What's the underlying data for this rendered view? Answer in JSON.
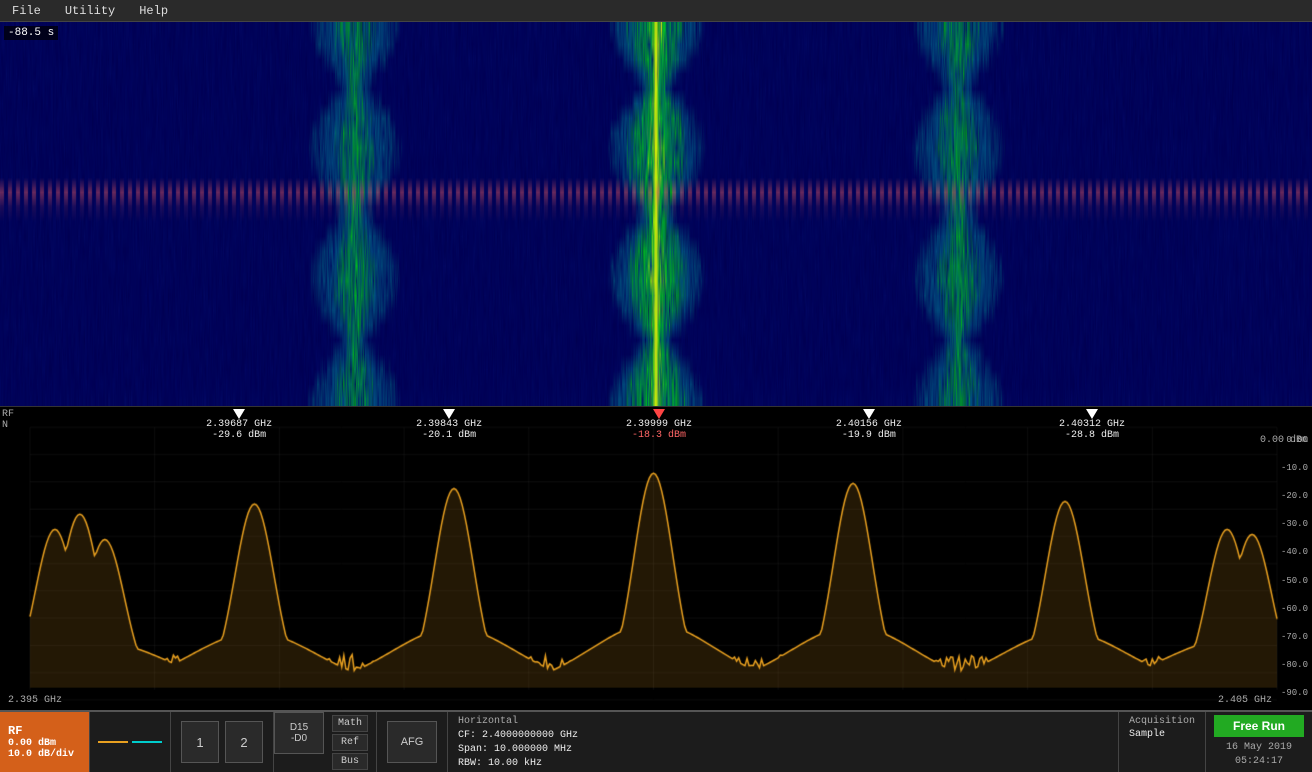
{
  "menu": {
    "file": "File",
    "utility": "Utility",
    "help": "Help"
  },
  "waterfall": {
    "time_label": "-88.5 s"
  },
  "spectrum": {
    "rf_label": "RF",
    "n_label": "N",
    "ref_level": "0.00 dBm",
    "x_start": "2.395 GHz",
    "x_end": "2.405 GHz",
    "y_axis": [
      "0.00",
      "-10.0",
      "-20.0",
      "-30.0",
      "-40.0",
      "-50.0",
      "-60.0",
      "-70.0",
      "-80.0",
      "-90.0"
    ],
    "markers": [
      {
        "id": "1",
        "freq": "2.39687 GHz",
        "power": "-29.6 dBm",
        "color": "white",
        "x_pct": 18
      },
      {
        "id": "2",
        "freq": "2.39843 GHz",
        "power": "-20.1 dBm",
        "color": "white",
        "x_pct": 34
      },
      {
        "id": "R",
        "freq": "2.39999 GHz",
        "power": "-18.3 dBm",
        "color": "red",
        "x_pct": 50
      },
      {
        "id": "4",
        "freq": "2.40156 GHz",
        "power": "-19.9 dBm",
        "color": "white",
        "x_pct": 66
      },
      {
        "id": "5",
        "freq": "2.40312 GHz",
        "power": "-28.8 dBm",
        "color": "white",
        "x_pct": 83
      }
    ]
  },
  "status_bar": {
    "rf_title": "RF",
    "rf_ref": "0.00 dBm",
    "rf_div": "10.0 dB/div",
    "channel_1": "1",
    "channel_2": "2",
    "d15_label": "D15\n-D0",
    "math_label": "Math",
    "ref_label": "Ref",
    "bus_label": "Bus",
    "afg_label": "AFG",
    "horizontal_title": "Horizontal",
    "cf_label": "CF:",
    "cf_value": "2.4000000000 GHz",
    "span_label": "Span:",
    "span_value": "10.000000 MHz",
    "rbw_label": "RBW:",
    "rbw_value": "10.00 kHz",
    "acquisition_title": "Acquisition",
    "acquisition_mode": "Sample",
    "free_run_label": "Free Run",
    "date": "16 May 2019",
    "time": "05:24:17"
  }
}
